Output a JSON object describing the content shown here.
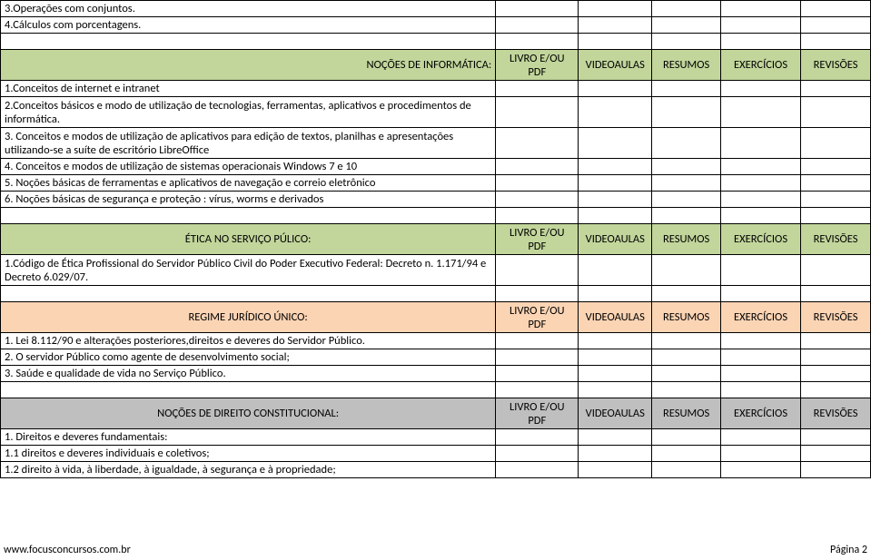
{
  "top_items": {
    "i1": "3.Operações com conjuntos.",
    "i2": "4.Cálculos com porcentagens."
  },
  "columns": {
    "c1": "LIVRO E/OU PDF",
    "c2": "VIDEOAULAS",
    "c3": "RESUMOS",
    "c4": "EXERCÍCIOS",
    "c5": "REVISÕES"
  },
  "sec_informatica": {
    "title": "NOÇÕES DE INFORMÁTICA:",
    "items": {
      "r1": "1.Conceitos de internet e intranet",
      "r2": "2.Conceitos básicos e modo de utilização de tecnologias, ferramentas, aplicativos e procedimentos de informática.",
      "r3": "3. Conceitos e modos de utilização de aplicativos para edição de textos, planilhas e apresentações utilizando-se a suíte de escritório LibreOffice",
      "r4": "4. Conceitos e modos de utilização de sistemas operacionais Windows 7 e 10",
      "r5": "5. Noções básicas de ferramentas e aplicativos de navegação e correio eletrônico",
      "r6": "6. Noções básicas de segurança e proteção : vírus, worms e derivados"
    }
  },
  "sec_etica": {
    "title": "ÉTICA NO SERVIÇO PÚLICO:",
    "items": {
      "r1": "1.Código de Ética Profissional do Servidor Público Civil do Poder Executivo Federal: Decreto n. 1.171/94 e Decreto 6.029/07."
    }
  },
  "sec_regime": {
    "title": "REGIME JURÍDICO ÚNICO:",
    "items": {
      "r1": "1. Lei 8.112/90 e alterações posteriores,direitos e deveres do Servidor Público.",
      "r2": "2. O servidor Público como agente de desenvolvimento social;",
      "r3": "3. Saúde e qualidade de vida no Serviço Público."
    }
  },
  "sec_constitucional": {
    "title": "NOÇÕES DE DIREITO CONSTITUCIONAL:",
    "items": {
      "r1": "1. Direitos e deveres fundamentais:",
      "r2": "1.1 direitos e deveres individuais e coletivos;",
      "r3": "1.2 direito à vida, à liberdade, à igualdade, à segurança e à propriedade;"
    }
  },
  "footer": {
    "left": "www.focusconcursos.com.br",
    "right": "Página 2"
  }
}
